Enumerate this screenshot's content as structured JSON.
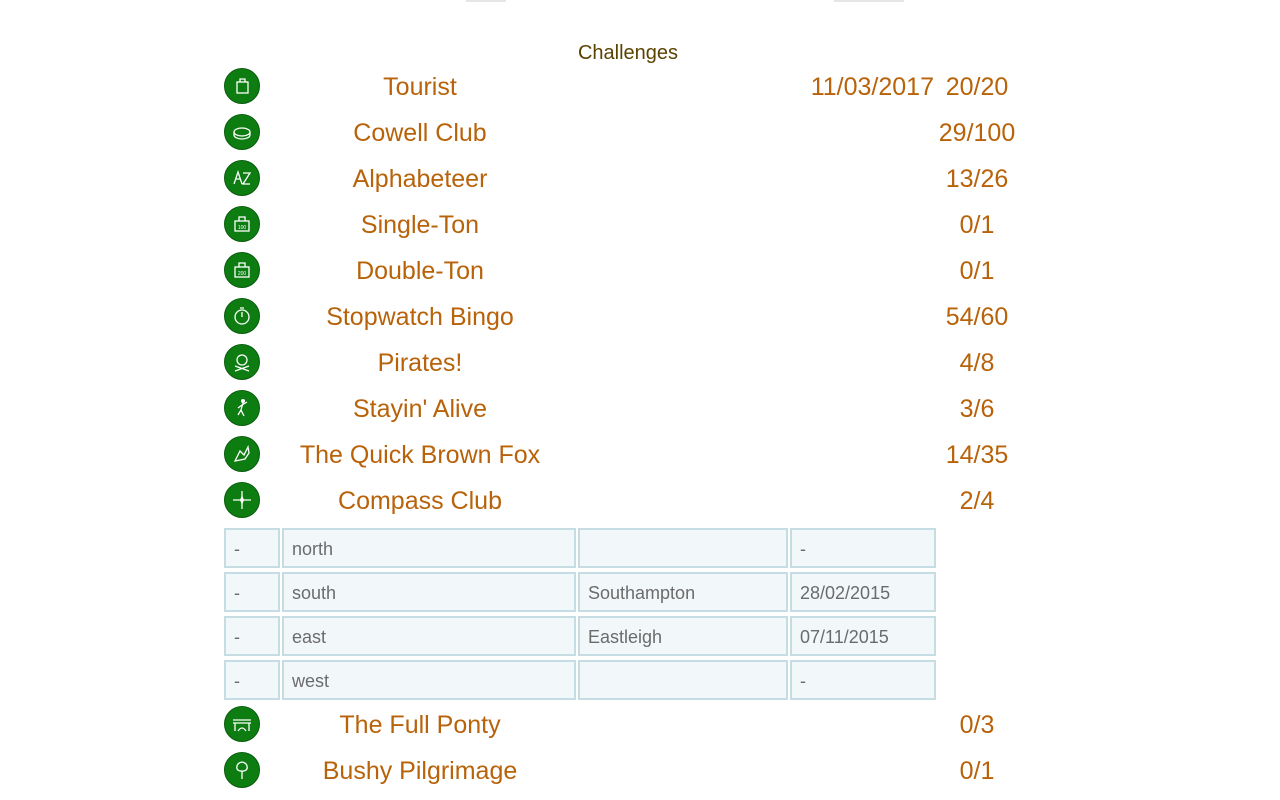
{
  "heading": "Challenges",
  "colors": {
    "badge": "#0d7d12",
    "text": "#b8620a",
    "cell_bg": "#f2f8fa",
    "cell_border": "#c6dce3"
  },
  "challenges_before": [
    {
      "icon": "tourist-icon",
      "name": "Tourist",
      "date": "11/03/2017",
      "score": "20/20"
    },
    {
      "icon": "cowell-club-icon",
      "name": "Cowell Club",
      "date": "",
      "score": "29/100"
    },
    {
      "icon": "alphabeteer-icon",
      "name": "Alphabeteer",
      "date": "",
      "score": "13/26"
    },
    {
      "icon": "single-ton-icon",
      "name": "Single-Ton",
      "date": "",
      "score": "0/1"
    },
    {
      "icon": "double-ton-icon",
      "name": "Double-Ton",
      "date": "",
      "score": "0/1"
    },
    {
      "icon": "stopwatch-bingo-icon",
      "name": "Stopwatch Bingo",
      "date": "",
      "score": "54/60"
    },
    {
      "icon": "pirates-icon",
      "name": "Pirates!",
      "date": "",
      "score": "4/8"
    },
    {
      "icon": "stayin-alive-icon",
      "name": "Stayin' Alive",
      "date": "",
      "score": "3/6"
    },
    {
      "icon": "quick-brown-fox-icon",
      "name": "The Quick Brown Fox",
      "date": "",
      "score": "14/35"
    },
    {
      "icon": "compass-club-icon",
      "name": "Compass Club",
      "date": "",
      "score": "2/4"
    }
  ],
  "compass_details": [
    {
      "status": "-",
      "direction": "north",
      "event": "",
      "date": "-"
    },
    {
      "status": "-",
      "direction": "south",
      "event": "Southampton",
      "date": "28/02/2015"
    },
    {
      "status": "-",
      "direction": "east",
      "event": "Eastleigh",
      "date": "07/11/2015"
    },
    {
      "status": "-",
      "direction": "west",
      "event": "",
      "date": "-"
    }
  ],
  "challenges_after": [
    {
      "icon": "full-ponty-icon",
      "name": "The Full Ponty",
      "date": "",
      "score": "0/3"
    },
    {
      "icon": "bushy-pilgrimage-icon",
      "name": "Bushy Pilgrimage",
      "date": "",
      "score": "0/1"
    }
  ]
}
